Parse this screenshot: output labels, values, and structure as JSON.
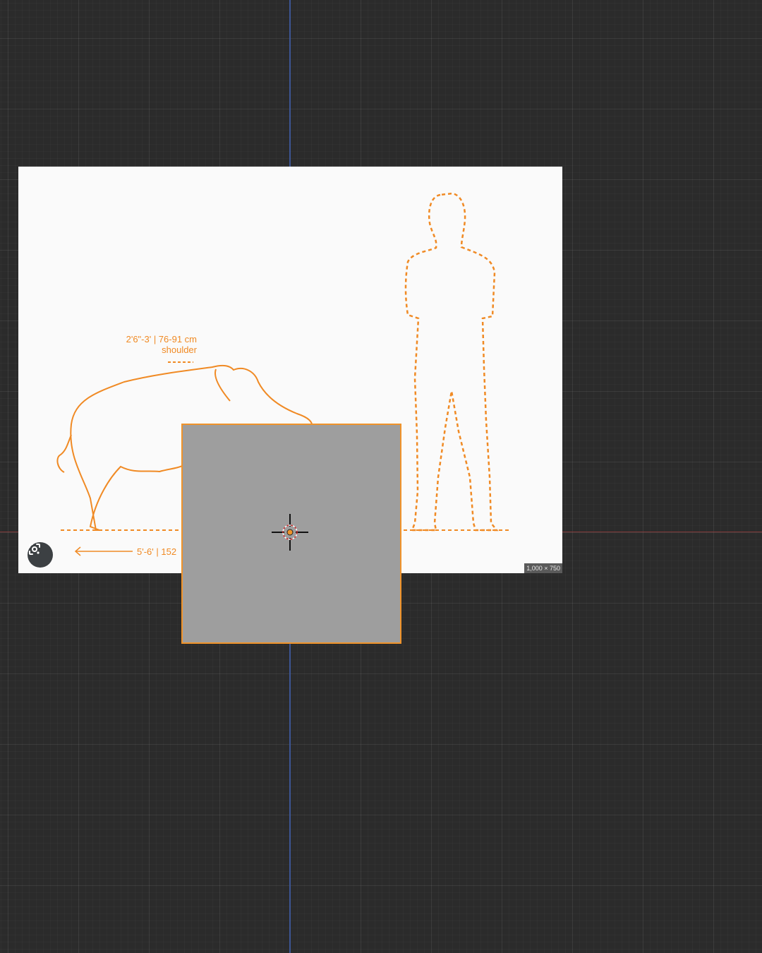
{
  "viewport": {
    "grid_color": "#3a3a3a",
    "background_color": "#2b2b2b",
    "axis_x_color": "#8a3a3a",
    "axis_y_color": "#3e5a9e"
  },
  "reference_image": {
    "height_label": "2'6\"-3' | 76-91 cm",
    "height_sublabel": "shoulder",
    "length_label": "5'-6' | 152",
    "size_label": "1,000 × 750",
    "accent_color": "#f08a24",
    "lens_icon": "google-lens-icon"
  },
  "plane_object": {
    "fill_color": "#9e9e9e",
    "outline_color": "#f0932a",
    "selected": true
  },
  "cursor": {
    "icon": "3d-cursor-crosshair-icon",
    "origin_color": "#f0932a"
  }
}
